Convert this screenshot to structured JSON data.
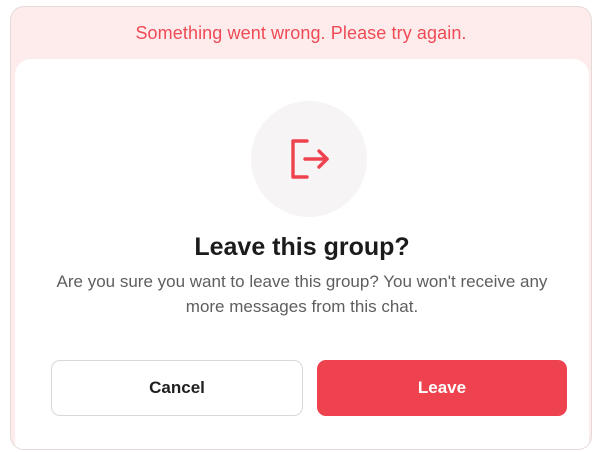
{
  "error_banner": {
    "message": "Something went wrong. Please try again.",
    "color": "#ef4a55"
  },
  "dialog": {
    "icon": "leave-icon",
    "title": "Leave this group?",
    "description": "Are you sure you want to leave this group? You won't receive any more messages from this chat.",
    "cancel_label": "Cancel",
    "confirm_label": "Leave",
    "accent_color": "#ee434e"
  }
}
